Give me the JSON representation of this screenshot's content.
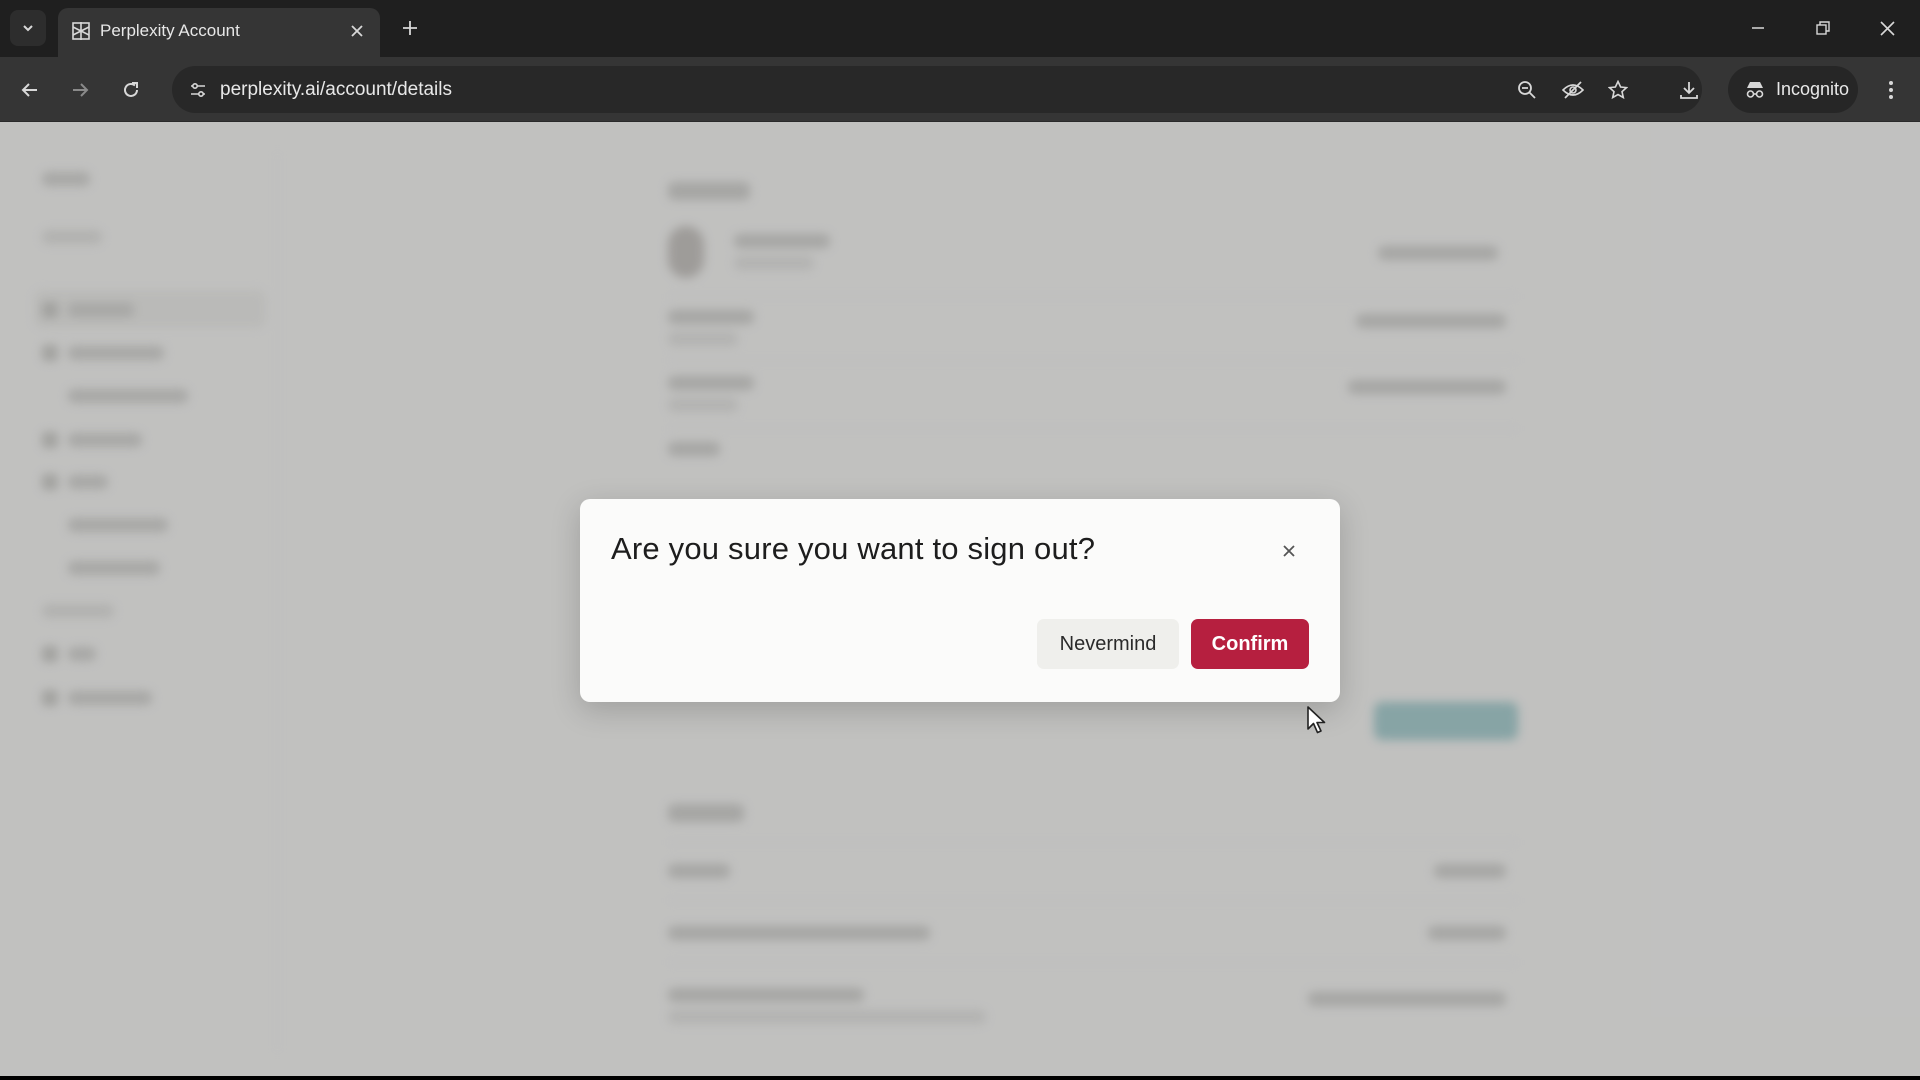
{
  "browser": {
    "tab": {
      "title": "Perplexity Account"
    },
    "omnibox": {
      "url": "perplexity.ai/account/details"
    },
    "incognito_label": "Incognito",
    "icons": {
      "tab_search": "chevron-down-icon",
      "tab_close": "close-icon",
      "new_tab": "plus-icon",
      "back": "arrow-left-icon",
      "forward": "arrow-right-icon",
      "reload": "reload-icon",
      "site_info": "tune-icon",
      "zoom": "zoom-icon",
      "tracking": "eye-off-icon",
      "bookmark": "star-icon",
      "download": "download-icon",
      "menu": "more-vertical-icon"
    }
  },
  "dialog": {
    "title": "Are you sure you want to sign out?",
    "cancel_label": "Nevermind",
    "confirm_label": "Confirm"
  },
  "colors": {
    "confirm": "#b61f3f",
    "page_background": "#f7f7f5",
    "chrome_dark": "#1f1f1f",
    "teal_accent": "#8fc3c6"
  }
}
